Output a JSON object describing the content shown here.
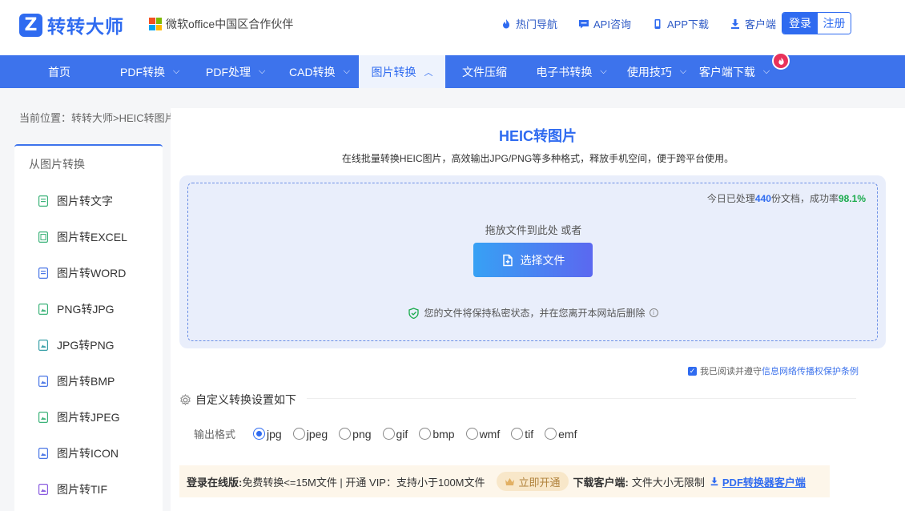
{
  "header": {
    "logo_text": "转转大师",
    "partner": "微软office中国区合作伙伴",
    "links": [
      "热门导航",
      "API咨询",
      "APP下载",
      "客户端"
    ],
    "login": "登录",
    "register": "注册"
  },
  "nav": {
    "items": [
      "首页",
      "PDF转换",
      "PDF处理",
      "CAD转换",
      "图片转换",
      "文件压缩",
      "电子书转换",
      "使用技巧",
      "客户端下载"
    ],
    "active": "图片转换"
  },
  "breadcrumb": "当前位置：转转大师>HEIC转图片",
  "sidebar": {
    "heading": "从图片转换",
    "items": [
      "图片转文字",
      "图片转EXCEL",
      "图片转WORD",
      "PNG转JPG",
      "JPG转PNG",
      "图片转BMP",
      "图片转JPEG",
      "图片转ICON",
      "图片转TIF"
    ]
  },
  "main": {
    "title": "HEIC转图片",
    "subtitle": "在线批量转换HEIC图片，高效输出JPG/PNG等多种格式，释放手机空间，便于跨平台使用。",
    "stats": {
      "prefix": "今日已处理",
      "count": "440",
      "middle": "份文档，成功率",
      "rate": "98.1%"
    },
    "drop_text": "拖放文件到此处 或者",
    "choose_button": "选择文件",
    "privacy": "您的文件将保持私密状态，并在您离开本网站后删除",
    "agree_prefix": "我已阅读并遵守",
    "agree_link": "信息网络传播权保护条例",
    "settings_title": "自定义转换设置如下",
    "format_label": "输出格式",
    "formats": [
      "jpg",
      "jpeg",
      "png",
      "gif",
      "bmp",
      "wmf",
      "tif",
      "emf"
    ],
    "selected_format": "jpg",
    "promo": {
      "online_label": "登录在线版:",
      "online_text": "免费转换<=15M文件 | 开通 VIP：支持小于100M文件",
      "vip_button": "立即开通",
      "client_label": "下载客户端:",
      "client_text": "文件大小无限制",
      "client_link": "PDF转换器客户端"
    }
  },
  "colors": {
    "primary": "#3d73ec",
    "accent": "#2f6bf0",
    "success": "#1aab4c",
    "hot": "#e8325a"
  }
}
